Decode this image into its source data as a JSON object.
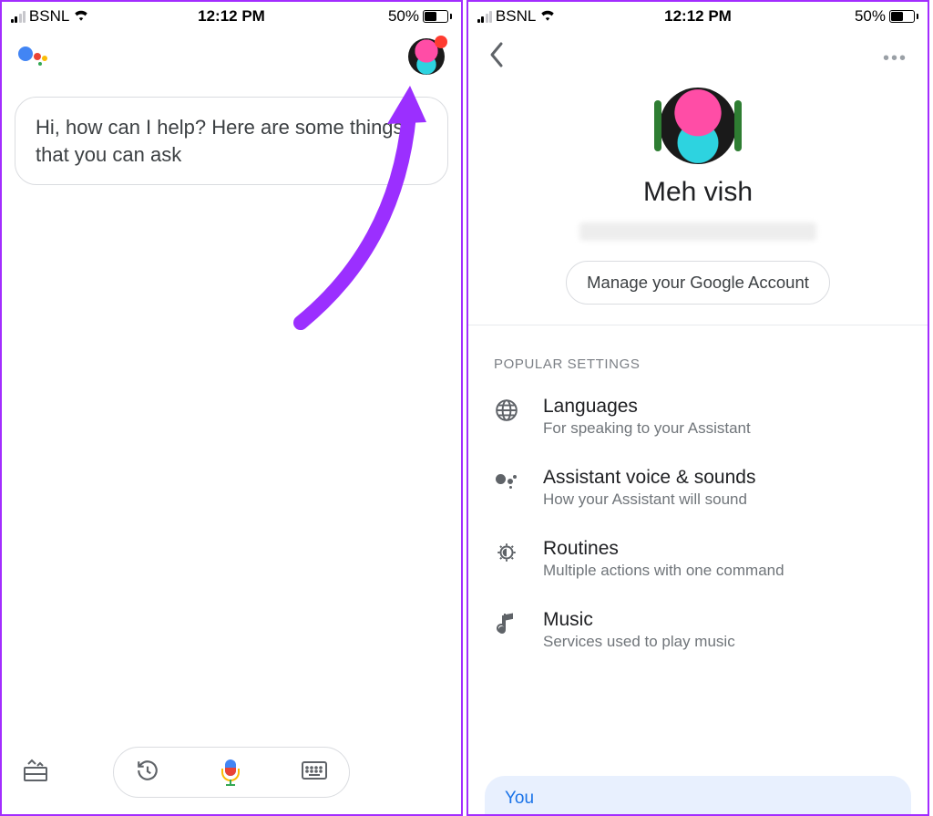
{
  "common": {
    "carrier": "BSNL",
    "time": "12:12 PM",
    "battery": "50%"
  },
  "screen1": {
    "bubble": "Hi, how can I help? Here are some things that you can ask"
  },
  "screen2": {
    "profile_name": "Meh vish",
    "manage_label": "Manage your Google Account",
    "section_label": "POPULAR SETTINGS",
    "settings": [
      {
        "title": "Languages",
        "subtitle": "For speaking to your Assistant"
      },
      {
        "title": "Assistant voice & sounds",
        "subtitle": "How your Assistant will sound"
      },
      {
        "title": "Routines",
        "subtitle": "Multiple actions with one command"
      },
      {
        "title": "Music",
        "subtitle": "Services used to play music"
      }
    ],
    "you_label": "You"
  }
}
